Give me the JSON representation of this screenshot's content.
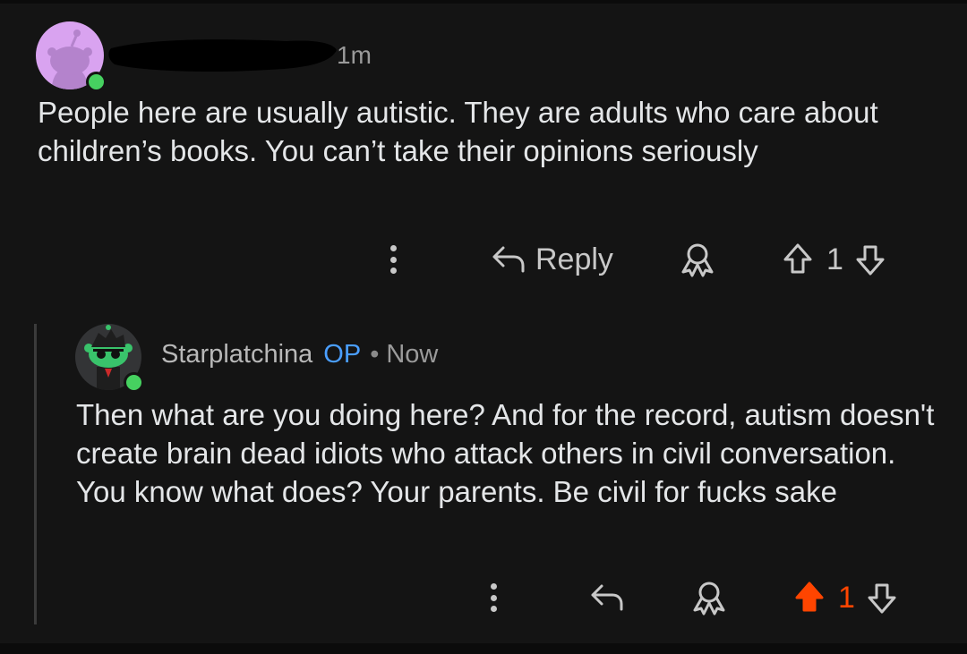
{
  "comment1": {
    "time": "1m",
    "body": "People here are usually autistic. They are adults who care about children’s books. You can’t take their opinions seriously",
    "actions": {
      "reply_label": "Reply",
      "score": "1"
    }
  },
  "comment2": {
    "author": "Starplatchina",
    "op_badge": "OP",
    "separator": "•",
    "time": "Now",
    "body": "Then what are you doing here? And for the record, autism doesn't create brain dead idiots who attack others in civil conversation. You know what does? Your parents. Be civil for fucks sake",
    "actions": {
      "score": "1",
      "upvoted": true
    }
  },
  "colors": {
    "background": "#141414",
    "upvote_active": "#ff4500",
    "op_badge": "#4a9eff",
    "online": "#46d160"
  }
}
